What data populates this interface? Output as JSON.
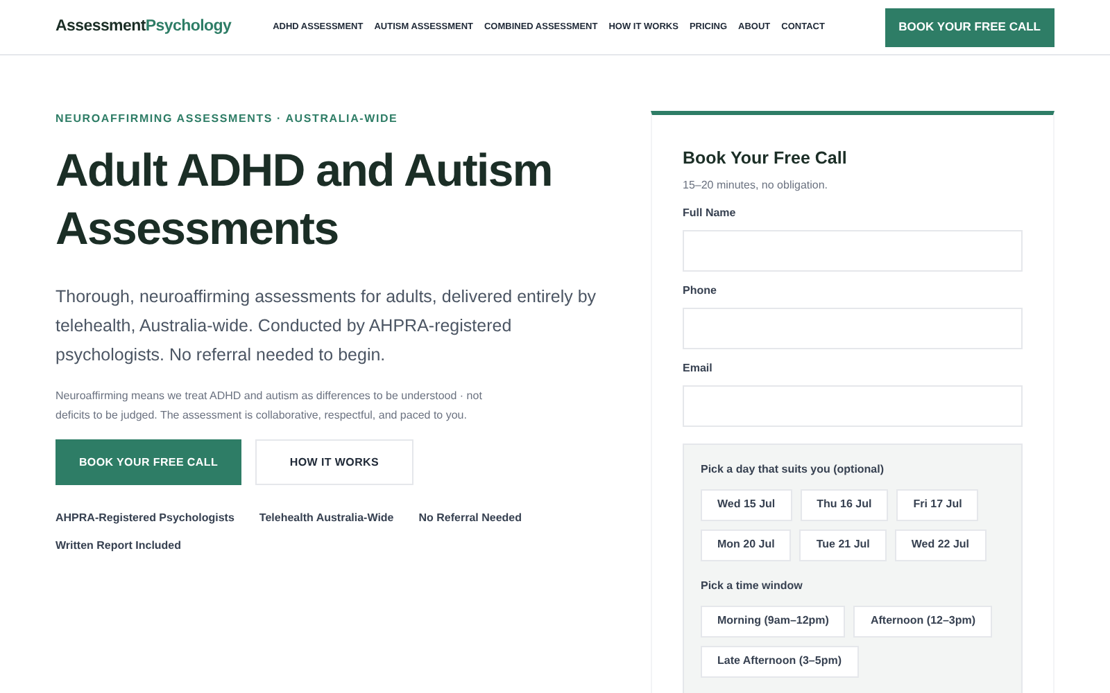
{
  "header": {
    "logo": {
      "part_1": "Assessment",
      "part_2": "Psychology"
    },
    "nav": [
      "ADHD ASSESSMENT",
      "AUTISM ASSESSMENT",
      "COMBINED ASSESSMENT",
      "HOW IT WORKS",
      "PRICING",
      "ABOUT",
      "CONTACT"
    ],
    "cta": "BOOK YOUR FREE CALL"
  },
  "hero": {
    "eyebrow": "NEUROAFFIRMING ASSESSMENTS · AUSTRALIA-WIDE",
    "title": "Adult ADHD and Autism Assessments",
    "lead": "Thorough, neuroaffirming assessments for adults, delivered entirely by telehealth, Australia-wide. Conducted by AHPRA-registered psychologists. No referral needed to begin.",
    "note": "Neuroaffirming means we treat ADHD and autism as differences to be understood · not deficits to be judged. The assessment is collaborative, respectful, and paced to you.",
    "buttons": [
      {
        "label": "BOOK YOUR FREE CALL",
        "kind": "primary"
      },
      {
        "label": "HOW IT WORKS",
        "kind": "secondary"
      }
    ],
    "badges": [
      "AHPRA-Registered Psychologists",
      "Telehealth Australia-Wide",
      "No Referral Needed",
      "Written Report Included"
    ]
  },
  "form": {
    "title": "Book Your Free Call",
    "subtitle": "15–20 minutes, no obligation.",
    "fields": [
      {
        "label": "Full Name"
      },
      {
        "label": "Phone"
      },
      {
        "label": "Email"
      }
    ],
    "day_label": "Pick a day that suits you (optional)",
    "days": [
      "Wed 15 Jul",
      "Thu 16 Jul",
      "Fri 17 Jul",
      "Mon 20 Jul",
      "Tue 21 Jul",
      "Wed 22 Jul"
    ],
    "time_label": "Pick a time window",
    "times": [
      "Morning (9am–12pm)",
      "Afternoon (12–3pm)",
      "Late Afternoon (3–5pm)"
    ]
  }
}
